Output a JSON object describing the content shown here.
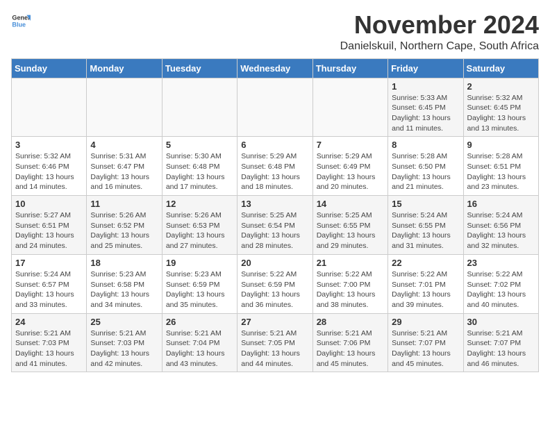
{
  "logo": {
    "text_general": "General",
    "text_blue": "Blue"
  },
  "title": {
    "month": "November 2024",
    "subtitle": "Danielskuil, Northern Cape, South Africa"
  },
  "headers": [
    "Sunday",
    "Monday",
    "Tuesday",
    "Wednesday",
    "Thursday",
    "Friday",
    "Saturday"
  ],
  "weeks": [
    [
      {
        "day": "",
        "info": ""
      },
      {
        "day": "",
        "info": ""
      },
      {
        "day": "",
        "info": ""
      },
      {
        "day": "",
        "info": ""
      },
      {
        "day": "",
        "info": ""
      },
      {
        "day": "1",
        "info": "Sunrise: 5:33 AM\nSunset: 6:45 PM\nDaylight: 13 hours and 11 minutes."
      },
      {
        "day": "2",
        "info": "Sunrise: 5:32 AM\nSunset: 6:45 PM\nDaylight: 13 hours and 13 minutes."
      }
    ],
    [
      {
        "day": "3",
        "info": "Sunrise: 5:32 AM\nSunset: 6:46 PM\nDaylight: 13 hours and 14 minutes."
      },
      {
        "day": "4",
        "info": "Sunrise: 5:31 AM\nSunset: 6:47 PM\nDaylight: 13 hours and 16 minutes."
      },
      {
        "day": "5",
        "info": "Sunrise: 5:30 AM\nSunset: 6:48 PM\nDaylight: 13 hours and 17 minutes."
      },
      {
        "day": "6",
        "info": "Sunrise: 5:29 AM\nSunset: 6:48 PM\nDaylight: 13 hours and 18 minutes."
      },
      {
        "day": "7",
        "info": "Sunrise: 5:29 AM\nSunset: 6:49 PM\nDaylight: 13 hours and 20 minutes."
      },
      {
        "day": "8",
        "info": "Sunrise: 5:28 AM\nSunset: 6:50 PM\nDaylight: 13 hours and 21 minutes."
      },
      {
        "day": "9",
        "info": "Sunrise: 5:28 AM\nSunset: 6:51 PM\nDaylight: 13 hours and 23 minutes."
      }
    ],
    [
      {
        "day": "10",
        "info": "Sunrise: 5:27 AM\nSunset: 6:51 PM\nDaylight: 13 hours and 24 minutes."
      },
      {
        "day": "11",
        "info": "Sunrise: 5:26 AM\nSunset: 6:52 PM\nDaylight: 13 hours and 25 minutes."
      },
      {
        "day": "12",
        "info": "Sunrise: 5:26 AM\nSunset: 6:53 PM\nDaylight: 13 hours and 27 minutes."
      },
      {
        "day": "13",
        "info": "Sunrise: 5:25 AM\nSunset: 6:54 PM\nDaylight: 13 hours and 28 minutes."
      },
      {
        "day": "14",
        "info": "Sunrise: 5:25 AM\nSunset: 6:55 PM\nDaylight: 13 hours and 29 minutes."
      },
      {
        "day": "15",
        "info": "Sunrise: 5:24 AM\nSunset: 6:55 PM\nDaylight: 13 hours and 31 minutes."
      },
      {
        "day": "16",
        "info": "Sunrise: 5:24 AM\nSunset: 6:56 PM\nDaylight: 13 hours and 32 minutes."
      }
    ],
    [
      {
        "day": "17",
        "info": "Sunrise: 5:24 AM\nSunset: 6:57 PM\nDaylight: 13 hours and 33 minutes."
      },
      {
        "day": "18",
        "info": "Sunrise: 5:23 AM\nSunset: 6:58 PM\nDaylight: 13 hours and 34 minutes."
      },
      {
        "day": "19",
        "info": "Sunrise: 5:23 AM\nSunset: 6:59 PM\nDaylight: 13 hours and 35 minutes."
      },
      {
        "day": "20",
        "info": "Sunrise: 5:22 AM\nSunset: 6:59 PM\nDaylight: 13 hours and 36 minutes."
      },
      {
        "day": "21",
        "info": "Sunrise: 5:22 AM\nSunset: 7:00 PM\nDaylight: 13 hours and 38 minutes."
      },
      {
        "day": "22",
        "info": "Sunrise: 5:22 AM\nSunset: 7:01 PM\nDaylight: 13 hours and 39 minutes."
      },
      {
        "day": "23",
        "info": "Sunrise: 5:22 AM\nSunset: 7:02 PM\nDaylight: 13 hours and 40 minutes."
      }
    ],
    [
      {
        "day": "24",
        "info": "Sunrise: 5:21 AM\nSunset: 7:03 PM\nDaylight: 13 hours and 41 minutes."
      },
      {
        "day": "25",
        "info": "Sunrise: 5:21 AM\nSunset: 7:03 PM\nDaylight: 13 hours and 42 minutes."
      },
      {
        "day": "26",
        "info": "Sunrise: 5:21 AM\nSunset: 7:04 PM\nDaylight: 13 hours and 43 minutes."
      },
      {
        "day": "27",
        "info": "Sunrise: 5:21 AM\nSunset: 7:05 PM\nDaylight: 13 hours and 44 minutes."
      },
      {
        "day": "28",
        "info": "Sunrise: 5:21 AM\nSunset: 7:06 PM\nDaylight: 13 hours and 45 minutes."
      },
      {
        "day": "29",
        "info": "Sunrise: 5:21 AM\nSunset: 7:07 PM\nDaylight: 13 hours and 45 minutes."
      },
      {
        "day": "30",
        "info": "Sunrise: 5:21 AM\nSunset: 7:07 PM\nDaylight: 13 hours and 46 minutes."
      }
    ]
  ]
}
